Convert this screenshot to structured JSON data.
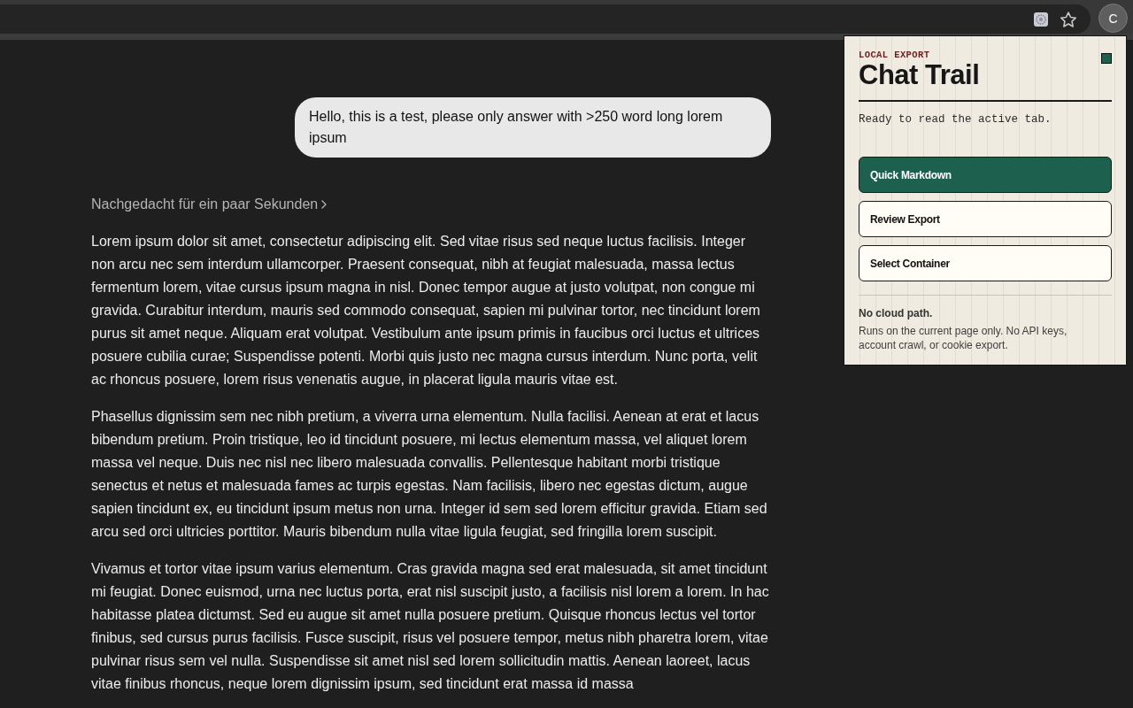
{
  "browser": {
    "profile_initial": "C"
  },
  "conversation": {
    "user_message": "Hello, this is a test, please only answer with >250 word long lorem ipsum",
    "thinking_label": "Nachgedacht für ein paar Sekunden",
    "answer_paragraphs": [
      "Lorem ipsum dolor sit amet, consectetur adipiscing elit. Sed vitae risus sed neque luctus facilisis. Integer non arcu nec sem interdum ullamcorper. Praesent consequat, nibh at feugiat malesuada, massa lectus fermentum lorem, vitae cursus ipsum magna in nisl. Donec tempor augue at justo volutpat, non congue mi gravida. Curabitur interdum, mauris sed commodo consequat, sapien mi pulvinar tortor, nec tincidunt lorem purus sit amet neque. Aliquam erat volutpat. Vestibulum ante ipsum primis in faucibus orci luctus et ultrices posuere cubilia curae; Suspendisse potenti. Morbi quis justo nec magna cursus interdum. Nunc porta, velit ac rhoncus posuere, lorem risus venenatis augue, in placerat ligula mauris vitae est.",
      "Phasellus dignissim sem nec nibh pretium, a viverra urna elementum. Nulla facilisi. Aenean at erat et lacus bibendum pretium. Proin tristique, leo id tincidunt posuere, mi lectus elementum massa, vel aliquet lorem massa vel neque. Duis nec nisl nec libero malesuada convallis. Pellentesque habitant morbi tristique senectus et netus et malesuada fames ac turpis egestas. Nam facilisis, libero nec egestas dictum, augue sapien tincidunt ex, eu tincidunt ipsum metus non urna. Integer id sem sed lorem efficitur gravida. Etiam sed arcu sed orci ultricies porttitor. Mauris bibendum nulla vitae ligula feugiat, sed fringilla lorem suscipit.",
      "Vivamus et tortor vitae ipsum varius elementum. Cras gravida magna sed erat malesuada, sit amet tincidunt mi feugiat. Donec euismod, urna nec luctus porta, erat nisl suscipit justo, a facilisis nisl lorem a lorem. In hac habitasse platea dictumst. Sed eu augue sit amet nulla posuere pretium. Quisque rhoncus lectus vel tortor finibus, sed cursus purus facilisis. Fusce suscipit, risus vel posuere tempor, metus nibh pharetra lorem, vitae pulvinar risus sem vel nulla. Suspendisse sit amet nisl sed lorem sollicitudin mattis. Aenean laoreet, lacus vitae finibus rhoncus, neque lorem dignissim ipsum, sed tincidunt erat massa id massa"
    ]
  },
  "popup": {
    "eyebrow": "LOCAL EXPORT",
    "title": "Chat Trail",
    "status": "Ready to read the active tab.",
    "actions": [
      {
        "label": "Quick Markdown",
        "kind": "primary"
      },
      {
        "label": "Review Export",
        "kind": "secondary"
      },
      {
        "label": "Select Container",
        "kind": "secondary"
      }
    ],
    "note_title": "No cloud path.",
    "note_text": "Runs on the current page only. No API keys, account crawl, or cookie export."
  }
}
